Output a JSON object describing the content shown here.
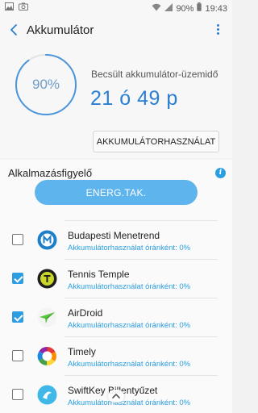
{
  "statusbar": {
    "battery_pct": "90%",
    "time": "19:43"
  },
  "appbar": {
    "title": "Akkumulátor"
  },
  "battery": {
    "percent_label": "90%",
    "level": 0.9,
    "estimate_label": "Becsült akkumulátor-üzemidő",
    "estimate_value": "21 ó 49 p",
    "usage_button": "AKKUMULÁTORHASZNÁLAT"
  },
  "monitor": {
    "title": "Alkalmazásfigyelő",
    "energ_button": "ENERG.TAK.",
    "apps": [
      {
        "name": "Budapesti Menetrend",
        "usage": "Akkumulátorhasználat óránként: 0%",
        "checked": false,
        "icon": "budapest-menetrend-icon"
      },
      {
        "name": "Tennis Temple",
        "usage": "Akkumulátorhasználat óránként: 0%",
        "checked": true,
        "icon": "tennis-temple-icon"
      },
      {
        "name": "AirDroid",
        "usage": "Akkumulátorhasználat óránként: 0%",
        "checked": true,
        "icon": "airdroid-icon"
      },
      {
        "name": "Timely",
        "usage": "Akkumulátorhasználat óránként: 0%",
        "checked": false,
        "icon": "timely-icon"
      },
      {
        "name": "SwiftKey Billentyűzet",
        "usage": "Akkumulátorhasználat óránként: 0%",
        "checked": false,
        "icon": "swiftkey-icon"
      }
    ]
  },
  "colors": {
    "accent": "#2a7fd3",
    "button_blue": "#5eb4ec",
    "usage_text": "#2a9ee0"
  }
}
